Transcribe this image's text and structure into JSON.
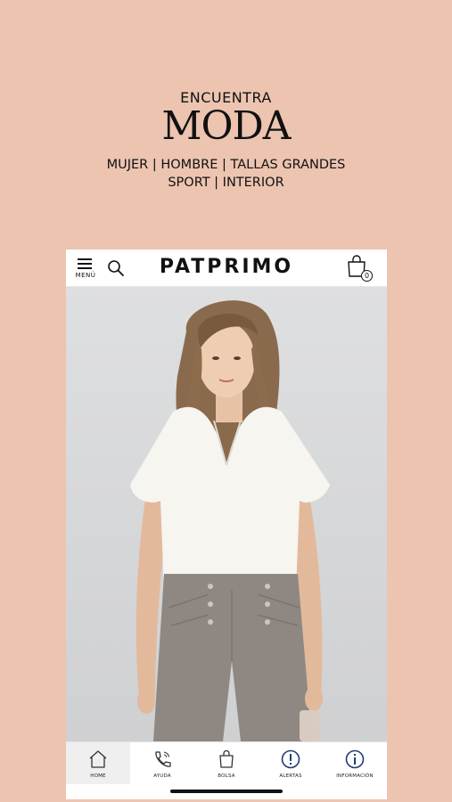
{
  "promo": {
    "kicker": "ENCUENTRA",
    "headline": "MODA",
    "categories_line1": "MUJER | HOMBRE | TALLAS GRANDES",
    "categories_line2": "SPORT | INTERIOR"
  },
  "app": {
    "brand": "PATPRIMO",
    "menu_label": "MENÚ",
    "bag_count": "0"
  },
  "tabs": [
    {
      "label": "HOME",
      "icon": "home-icon",
      "active": true
    },
    {
      "label": "AYUDA",
      "icon": "phone-icon",
      "active": false
    },
    {
      "label": "BOLSA",
      "icon": "shopping-bag-icon",
      "active": false
    },
    {
      "label": "ALERTAS",
      "icon": "alert-icon",
      "active": false
    },
    {
      "label": "INFORMACIÓN",
      "icon": "info-icon",
      "active": false
    }
  ],
  "colors": {
    "background": "#ecc4b0",
    "hero_background": "#dedfe1",
    "blouse": "#f6f5f0",
    "trousers": "#8f8882"
  }
}
